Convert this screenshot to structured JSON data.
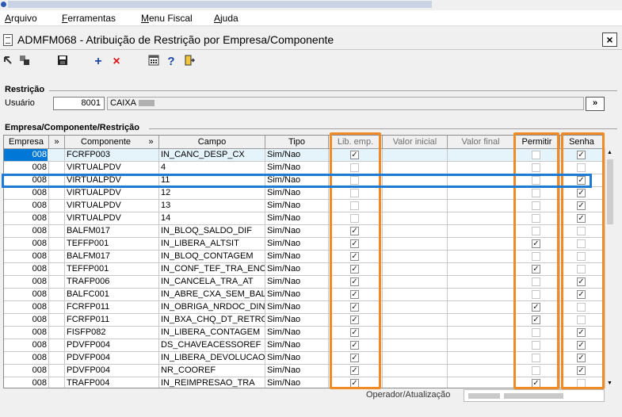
{
  "menu": [
    {
      "label": "Arquivo",
      "key": "A"
    },
    {
      "label": "Ferramentas",
      "key": "F"
    },
    {
      "label": "Menu Fiscal",
      "key": "M"
    },
    {
      "label": "Ajuda",
      "key": "A"
    }
  ],
  "window": {
    "title": "ADMFM068 - Atribuição de Restrição por Empresa/Componente",
    "close_label": "×"
  },
  "toolbar": {
    "add_label": "+",
    "delete_label": "×",
    "help_label": "?"
  },
  "restricao": {
    "section_label": "Restrição",
    "usuario_label": "Usuário",
    "user_code": "8001",
    "user_name": "CAIXA",
    "lookup_label": "»"
  },
  "grid": {
    "section_label": "Empresa/Componente/Restrição",
    "columns": {
      "empresa": "Empresa",
      "componente": "Componente",
      "campo": "Campo",
      "tipo": "Tipo",
      "lib_emp": "Lib. emp.",
      "valor_inicial": "Valor inicial",
      "valor_final": "Valor final",
      "permitir": "Permitir",
      "senha": "Senha",
      "sort_label": "»"
    },
    "rows": [
      {
        "empresa": "008",
        "componente": "FCRFP003",
        "campo": "IN_CANC_DESP_CX",
        "tipo": "Sim/Nao",
        "lib_emp": true,
        "permitir": false,
        "senha": true
      },
      {
        "empresa": "008",
        "componente": "VIRTUALPDV",
        "campo": "4",
        "tipo": "Sim/Nao",
        "lib_emp": false,
        "permitir": false,
        "senha": false
      },
      {
        "empresa": "008",
        "componente": "VIRTUALPDV",
        "campo": "11",
        "tipo": "Sim/Nao",
        "lib_emp": false,
        "permitir": false,
        "senha": true
      },
      {
        "empresa": "008",
        "componente": "VIRTUALPDV",
        "campo": "12",
        "tipo": "Sim/Nao",
        "lib_emp": false,
        "permitir": false,
        "senha": true
      },
      {
        "empresa": "008",
        "componente": "VIRTUALPDV",
        "campo": "13",
        "tipo": "Sim/Nao",
        "lib_emp": false,
        "permitir": false,
        "senha": true
      },
      {
        "empresa": "008",
        "componente": "VIRTUALPDV",
        "campo": "14",
        "tipo": "Sim/Nao",
        "lib_emp": false,
        "permitir": false,
        "senha": true
      },
      {
        "empresa": "008",
        "componente": "BALFM017",
        "campo": "IN_BLOQ_SALDO_DIF",
        "tipo": "Sim/Nao",
        "lib_emp": true,
        "permitir": false,
        "senha": false
      },
      {
        "empresa": "008",
        "componente": "TEFFP001",
        "campo": "IN_LIBERA_ALTSIT",
        "tipo": "Sim/Nao",
        "lib_emp": true,
        "permitir": true,
        "senha": false
      },
      {
        "empresa": "008",
        "componente": "BALFM017",
        "campo": "IN_BLOQ_CONTAGEM",
        "tipo": "Sim/Nao",
        "lib_emp": true,
        "permitir": false,
        "senha": false
      },
      {
        "empresa": "008",
        "componente": "TEFFP001",
        "campo": "IN_CONF_TEF_TRA_ENC",
        "tipo": "Sim/Nao",
        "lib_emp": true,
        "permitir": true,
        "senha": false
      },
      {
        "empresa": "008",
        "componente": "TRAFP006",
        "campo": "IN_CANCELA_TRA_AT",
        "tipo": "Sim/Nao",
        "lib_emp": true,
        "permitir": false,
        "senha": true
      },
      {
        "empresa": "008",
        "componente": "BALFC001",
        "campo": "IN_ABRE_CXA_SEM_BAL",
        "tipo": "Sim/Nao",
        "lib_emp": true,
        "permitir": false,
        "senha": true
      },
      {
        "empresa": "008",
        "componente": "FCRFP011",
        "campo": "IN_OBRIGA_NRDOC_DIN",
        "tipo": "Sim/Nao",
        "lib_emp": true,
        "permitir": true,
        "senha": false
      },
      {
        "empresa": "008",
        "componente": "FCRFP011",
        "campo": "IN_BXA_CHQ_DT_RETRO",
        "tipo": "Sim/Nao",
        "lib_emp": true,
        "permitir": true,
        "senha": false
      },
      {
        "empresa": "008",
        "componente": "FISFP082",
        "campo": "IN_LIBERA_CONTAGEM",
        "tipo": "Sim/Nao",
        "lib_emp": true,
        "permitir": false,
        "senha": true
      },
      {
        "empresa": "008",
        "componente": "PDVFP004",
        "campo": "DS_CHAVEACESSOREF",
        "tipo": "Sim/Nao",
        "lib_emp": true,
        "permitir": false,
        "senha": true
      },
      {
        "empresa": "008",
        "componente": "PDVFP004",
        "campo": "IN_LIBERA_DEVOLUCAO",
        "tipo": "Sim/Nao",
        "lib_emp": true,
        "permitir": false,
        "senha": true
      },
      {
        "empresa": "008",
        "componente": "PDVFP004",
        "campo": "NR_COOREF",
        "tipo": "Sim/Nao",
        "lib_emp": true,
        "permitir": false,
        "senha": true
      },
      {
        "empresa": "008",
        "componente": "TRAFP004",
        "campo": "IN_REIMPRESAO_TRA",
        "tipo": "Sim/Nao",
        "lib_emp": true,
        "permitir": true,
        "senha": false
      }
    ]
  },
  "status": {
    "operador_label": "Operador/Atualização"
  },
  "colors": {
    "highlight_orange": "#f08a24",
    "highlight_blue": "#1f7ad6",
    "selection": "#0078d7"
  }
}
